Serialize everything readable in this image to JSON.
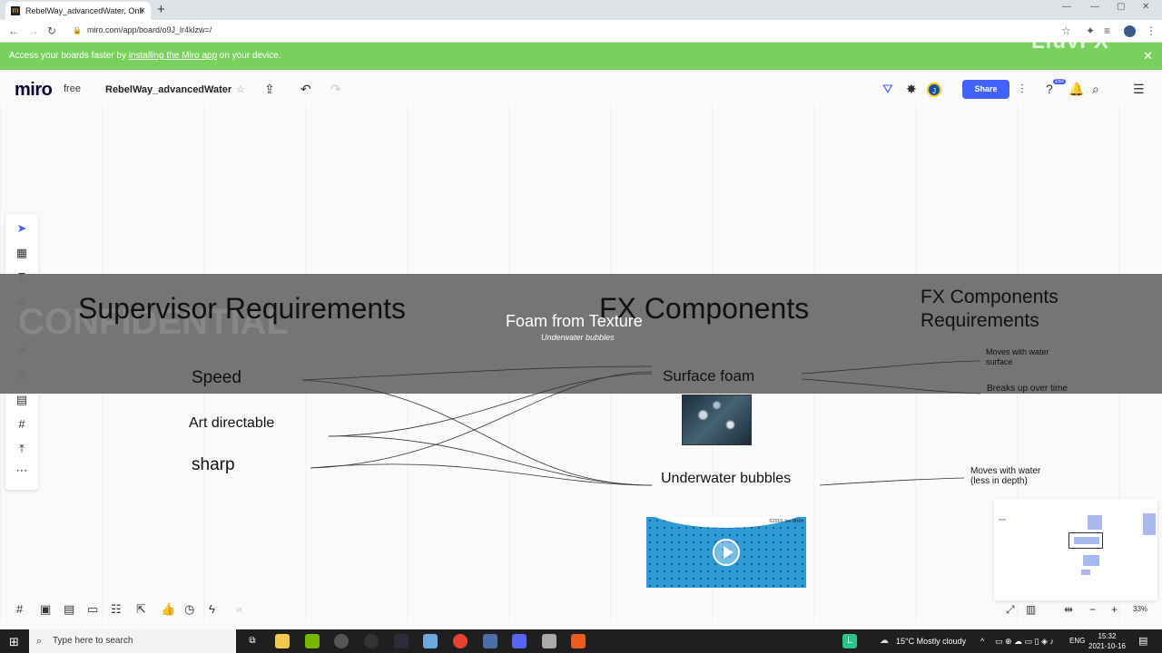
{
  "browser": {
    "tab_title": "RebelWay_advancedWater, Onli",
    "url": "miro.com/app/board/o9J_lr4klzw=/"
  },
  "notice": {
    "prefix": "Access your boards faster by ",
    "link": "installing the Miro app",
    "suffix": " on your device."
  },
  "watermark": "LiuvFX",
  "miro": {
    "logo": "miro",
    "plan": "free",
    "board_name": "RebelWay_advancedWater",
    "share_label": "Share",
    "avatar_initial": "J",
    "notification_count": "152"
  },
  "board": {
    "headings": {
      "supervisor": "Supervisor Requirements",
      "fx_components": "FX Components",
      "fx_requirements": "FX Components Requirements"
    },
    "foam_title": "Foam from Texture",
    "foam_subtitle": "Underwater bubbles",
    "supervisor_items": [
      "Speed",
      "Art directable",
      "sharp"
    ],
    "components": [
      "Surface foam",
      "Underwater bubbles"
    ],
    "requirements": [
      "Moves with water surface",
      "Breaks up over time",
      "Moves with water (less in depth)"
    ],
    "ghost_text": "CONFIDENTIAL",
    "video_copyright": "©2019 Jon Blyth"
  },
  "zoom_level": "33%",
  "taskbar": {
    "search_placeholder": "Type here to search",
    "weather": "15°C  Mostly cloudy",
    "language": "ENG",
    "time": "15:32",
    "date": "2021-10-16"
  }
}
